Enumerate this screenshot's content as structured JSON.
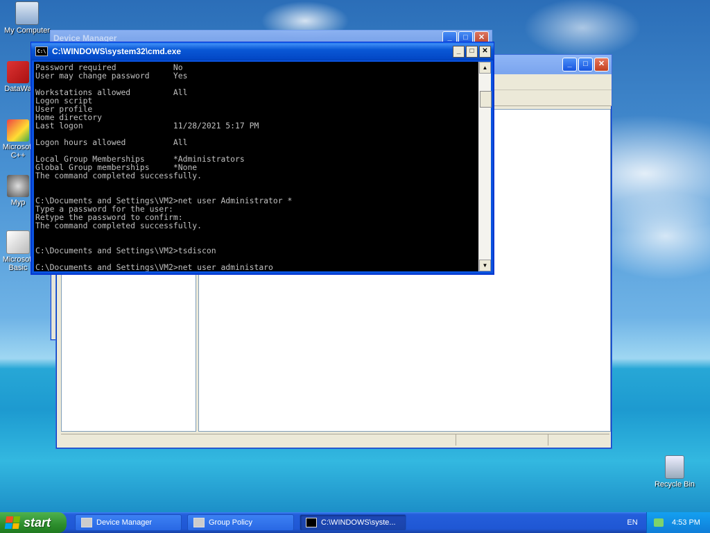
{
  "desktop_icons": [
    {
      "id": "my-computer",
      "label": "My Computer"
    },
    {
      "id": "datawa",
      "label": "DataWa"
    },
    {
      "id": "ms-cpp",
      "label": "Microsoft C++"
    },
    {
      "id": "myp",
      "label": "Myp"
    },
    {
      "id": "ms-basic",
      "label": "Microsoft Basic"
    },
    {
      "id": "recycle-bin",
      "label": "Recycle Bin"
    }
  ],
  "windows": {
    "device_manager": {
      "title": "Device Manager"
    },
    "group_policy": {
      "title": ""
    },
    "cmd": {
      "title": "C:\\WINDOWS\\system32\\cmd.exe",
      "icon_text": "C:\\",
      "lines": [
        "Password required            No",
        "User may change password     Yes",
        "",
        "Workstations allowed         All",
        "Logon script",
        "User profile",
        "Home directory",
        "Last logon                   11/28/2021 5:17 PM",
        "",
        "Logon hours allowed          All",
        "",
        "Local Group Memberships      *Administrators",
        "Global Group memberships     *None",
        "The command completed successfully.",
        "",
        "",
        "C:\\Documents and Settings\\VM2>net user Administrator *",
        "Type a password for the user:",
        "Retype the password to confirm:",
        "The command completed successfully.",
        "",
        "",
        "C:\\Documents and Settings\\VM2>tsdiscon",
        "",
        "C:\\Documents and Settings\\VM2>net user administaro"
      ]
    }
  },
  "taskbar": {
    "start_label": "start",
    "tasks": [
      {
        "label": "Device Manager",
        "active": false
      },
      {
        "label": "Group Policy",
        "active": false
      },
      {
        "label": "C:\\WINDOWS\\syste...",
        "active": true
      }
    ],
    "language": "EN",
    "clock": "4:53 PM"
  },
  "colors": {
    "console_bg": "#000000",
    "console_fg": "#c0c0c0",
    "taskbar": "#245edb",
    "start": "#2d8e2d"
  }
}
